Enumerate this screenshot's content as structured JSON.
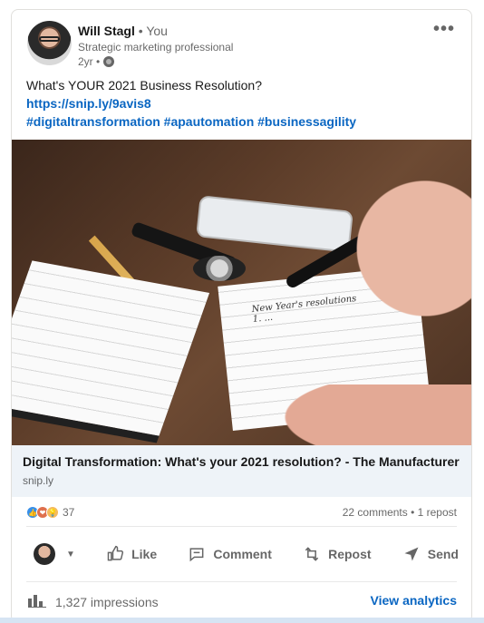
{
  "author": {
    "name": "Will Stagl",
    "you_label": " • You",
    "headline": "Strategic marketing professional",
    "time": "2yr •"
  },
  "post": {
    "text": "What's YOUR 2021 Business Resolution?",
    "link": "https://snip.ly/9avis8",
    "hashtags": "#digitaltransformation #apautomation #businessagility"
  },
  "image": {
    "paper_text": "New Year's resolutions\n1. ..."
  },
  "preview": {
    "title": "Digital Transformation: What's your 2021 resolution? - The Manufacturer",
    "source": "snip.ly"
  },
  "social": {
    "reaction_count": "37",
    "meta": "22 comments • 1 repost"
  },
  "actions": {
    "like": "Like",
    "comment": "Comment",
    "repost": "Repost",
    "send": "Send"
  },
  "footer": {
    "impressions": "1,327 impressions",
    "analytics": "View analytics"
  },
  "colors": {
    "accent": "#0a66c2",
    "preview_bg": "#eef3f8"
  }
}
